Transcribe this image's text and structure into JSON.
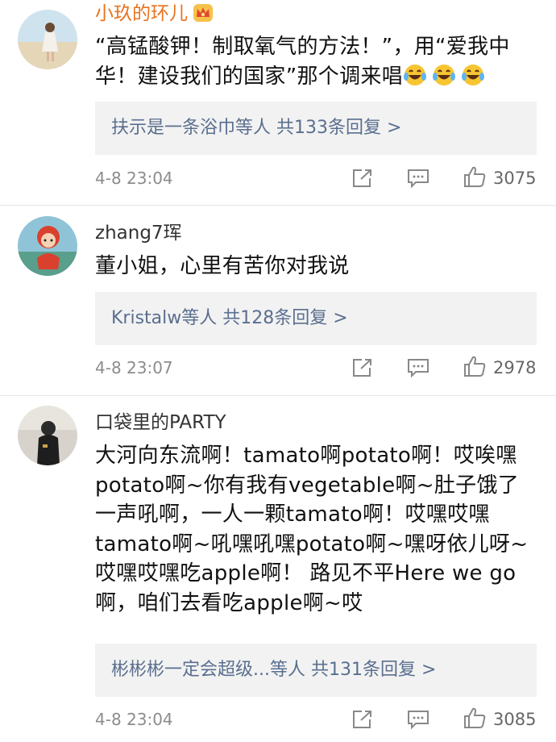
{
  "comments": [
    {
      "username": "小玖的环儿",
      "text": "“高锰酸钾！制取氧气的方法！”，用“爱我中华！建设我们的国家”那个调来唱",
      "line1": "“高锰酸钾！制取氧气的方法！”，用“爱我中",
      "line2": "华！建设我们的国家”那个调来唱",
      "replies": "扶示是一条浴巾等人  共133条回复 >",
      "time": "4-8 23:04",
      "likes": "3075",
      "badge_icon": "crown-badge-icon",
      "emoji_icon": "laughing-tears-emoji-icon"
    },
    {
      "username": "zhang7珲",
      "text": "董小姐，心里有苦你对我说",
      "replies": "Kristalw等人  共128条回复 >",
      "time": "4-8 23:07",
      "likes": "2978"
    },
    {
      "username": "口袋里的PARTY",
      "lines": [
        "大河向东流啊！tamato啊potato啊！哎唉嘿",
        "potato啊~你有我有vegetable啊~肚子饿了",
        "一声吼啊，一人一颗tamato啊！哎嘿哎嘿",
        "tamato啊~吼嘿吼嘿potato啊~嘿呀依儿呀~",
        "哎嘿哎嘿吃apple啊！ 路见不平Here we go",
        "啊，咱们去看吃apple啊~哎"
      ],
      "replies": "彬彬彬一定会超级...等人  共131条回复 >",
      "time": "4-8 23:04",
      "likes": "3085"
    }
  ],
  "icons": {
    "share": "share-icon",
    "comment": "comment-icon",
    "like": "thumbs-up-icon"
  },
  "colors": {
    "username_vip": "#e8731f",
    "reply_link": "#5a6f8f",
    "reply_bg": "#f2f2f2",
    "meta": "#8c8c8c"
  }
}
